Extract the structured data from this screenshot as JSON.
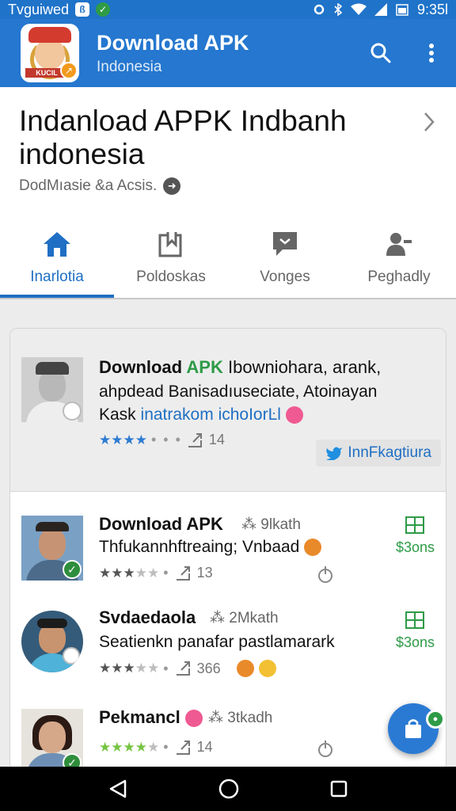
{
  "status_bar": {
    "left_text": "Tvguiwed",
    "time": "9:35l"
  },
  "app_bar": {
    "title": "Download APK",
    "subtitle": "Indonesia",
    "logo_banner": "KUCIL",
    "icons": [
      "search-icon",
      "more-vert-icon"
    ]
  },
  "header": {
    "title": "Indanload APPK Indbanh indonesia",
    "subtitle": "DodMıasie &a Acsis."
  },
  "tabs": [
    {
      "label": "Inarlotia",
      "icon": "home-icon",
      "active": true
    },
    {
      "label": "Poldoskas",
      "icon": "bookmark-icon",
      "active": false
    },
    {
      "label": "Vonges",
      "icon": "message-icon",
      "active": false
    },
    {
      "label": "Peghadly",
      "icon": "person-icon",
      "active": false
    }
  ],
  "featured": {
    "title_part1": "Download ",
    "title_apk": "APK",
    "title_rest": " Ibowniohara, arank,",
    "line2": "ahpdead Banisadıuseciate, Atoinayan",
    "line3_prefix": "Kask ",
    "line3_blue": "inatrakom ichoIorĿl",
    "rating": 3.5,
    "share_count": "14",
    "action_label": "InnFkagtiura"
  },
  "items": [
    {
      "title": "Download APK",
      "size": "9lkath",
      "subtitle": "Thfukannhftreaing; Vnbaad",
      "rating": 3,
      "share_count": "13",
      "right_label": "$3ons"
    },
    {
      "title": "Svdaedaola",
      "size": "2Mkath",
      "subtitle": "Seatienkn panafar pastlamarark",
      "rating": 2.5,
      "share_count": "366",
      "right_label": "$3ons"
    },
    {
      "title": "Pekmancl",
      "size": "3tkadh",
      "subtitle": "",
      "rating": 3.5,
      "share_count": "14",
      "right_label": ""
    }
  ],
  "colors": {
    "primary": "#2577cf",
    "accent_green": "#2e9b47",
    "tab_active": "#1f6fc4"
  }
}
